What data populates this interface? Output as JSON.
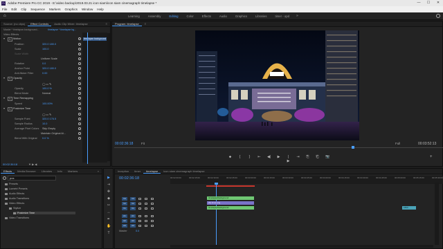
{
  "window": {
    "title": "Adobe Premiere Pro CC 2019 - E:\\video backup\\2019.03.21 icon siam\\icon siam cinemagraph timelapse *",
    "app_icon": "Pr",
    "minimize": "—",
    "maximize": "☐",
    "close": "✕"
  },
  "menu": [
    "File",
    "Edit",
    "Clip",
    "Sequence",
    "Markers",
    "Graphics",
    "Window",
    "Help"
  ],
  "workspaces": {
    "home": "⌂",
    "tabs": [
      "Learning",
      "Assembly",
      "Editing",
      "Color",
      "Effects",
      "Audio",
      "Graphics",
      "Libraries",
      "timer - opd"
    ],
    "active": "Editing",
    "more": "»"
  },
  "effect_controls": {
    "tabs": [
      "Source: (no clips)",
      "Effect Controls",
      "Audio Clip Mixer: timelapse"
    ],
    "menu_icon": "≡",
    "master": "Master * timelapse-background...",
    "clip": "timelapse * timelapse bg...",
    "tooltip": "timelapse background",
    "section_video": "Video Effects",
    "rows": [
      {
        "label": "Motion",
        "type": "fx-header"
      },
      {
        "label": "Position",
        "value": "320.0    180.0"
      },
      {
        "label": "Scale",
        "value": "100.0"
      },
      {
        "label": "Scale Width",
        "value": "",
        "dim": true
      },
      {
        "label": "",
        "value": "Uniform Scale",
        "checkbox": true
      },
      {
        "label": "Rotation",
        "value": "0.0"
      },
      {
        "label": "Anchor Point",
        "value": "320.0    180.0"
      },
      {
        "label": "Anti-flicker Filter",
        "value": "0.00"
      },
      {
        "label": "Opacity",
        "type": "fx-header"
      },
      {
        "label": "",
        "value": "◯ ▭ ✎",
        "shapes": true
      },
      {
        "label": "Opacity",
        "value": "100.0 %"
      },
      {
        "label": "Blend Mode",
        "value": "Normal",
        "dropdown": true
      },
      {
        "label": "Time Remapping",
        "type": "fx-header"
      },
      {
        "label": "Speed",
        "value": "100.00%"
      },
      {
        "label": "Posterize Time",
        "type": "fx-header"
      },
      {
        "label": "",
        "value": "◯ ▭ ✎",
        "shapes": true
      },
      {
        "label": "Sample Point",
        "value": "320.0    176.5"
      },
      {
        "label": "Sample Radius",
        "value": "10.0"
      },
      {
        "label": "Average Pixel Colors",
        "value": "Skip Empty",
        "dropdown": true
      },
      {
        "label": "",
        "value": "Maintain Original Al...",
        "checkbox": true
      },
      {
        "label": "Blend With Original",
        "value": "0.0 %"
      }
    ],
    "timecode": "00:02:36:18",
    "tc_icons": "▼ ▶ ◀"
  },
  "program": {
    "title": "Program: timelapse",
    "menu_icon": "≡",
    "timecode_left": "00:02:36:18",
    "fit": "Fit",
    "quality": "Full",
    "timecode_right": "00:03:52:13",
    "transport": [
      "⬥",
      "{",
      "}",
      "⇤",
      "◀|",
      "▶",
      "|▶",
      "⇥",
      "⎘",
      "⎗",
      "📷",
      "+"
    ]
  },
  "project": {
    "tabs": [
      "Effects",
      "Media Browser",
      "Libraries",
      "Info",
      "Markers"
    ],
    "menu_icon": "»",
    "search_value": "pos",
    "items": [
      {
        "label": "Presets",
        "depth": 0
      },
      {
        "label": "Lumetri Presets",
        "depth": 0
      },
      {
        "label": "Audio Effects",
        "depth": 0
      },
      {
        "label": "Audio Transitions",
        "depth": 0
      },
      {
        "label": "Video Effects",
        "depth": 0
      },
      {
        "label": "Stylize",
        "depth": 1
      },
      {
        "label": "Posterize Time",
        "depth": 2,
        "selected": true
      },
      {
        "label": "Video Transitions",
        "depth": 0
      }
    ]
  },
  "timeline": {
    "tabs": [
      "Inception",
      "timer",
      "timelapse",
      "icon siam cinemagraph timelapse"
    ],
    "active_tab": "timelapse",
    "timecode": "00:02:36:18",
    "ruler": [
      "00:02:00:00",
      "00:02:15:00",
      "00:02:30:00",
      "00:02:45:00",
      "00:03:00:00",
      "00:03:15:00",
      "00:03:30:00",
      "00:03:45:00",
      "00:04:00:00",
      "00:04:15:00",
      "00:04:30:00",
      "00:04:45:00",
      "00:05:00:00",
      "00:05:15:00",
      "00:05:30:00"
    ],
    "tracks": [
      "V3",
      "V2",
      "V1",
      "A1",
      "A2",
      "A3"
    ],
    "master": "Master",
    "master_value": "0.0",
    "clips": [
      {
        "track": "V3",
        "label": "timelapse/background"
      },
      {
        "track": "V2",
        "label": "[fx] timer.png"
      },
      {
        "track": "V1",
        "label": "timelapse/background"
      }
    ],
    "edge_clip": "1800"
  },
  "tools": [
    "▶",
    "⇥",
    "✥",
    "◆",
    "✂",
    "↔",
    "✒",
    "✋",
    "T"
  ],
  "colors": {
    "accent": "#4a9eff",
    "clip_green": "#6fc773",
    "clip_selected": "#7a72c8",
    "playhead": "#4a9eff",
    "render_bar": "#c8372d"
  }
}
